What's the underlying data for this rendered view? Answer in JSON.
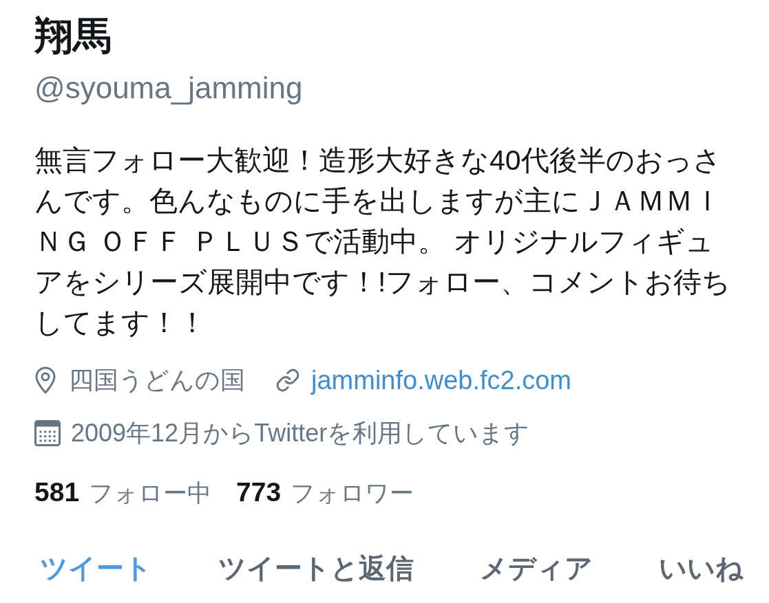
{
  "profile": {
    "name": "翔馬",
    "handle": "@syouma_jamming",
    "bio": "無言フォロー大歓迎！造形大好きな40代後半のおっさんです。色んなものに手を出しますが主にＪＡＭＭＩＮＧ ＯＦＦ ＰＬＵＳで活動中。 オリジナルフィギュアをシリーズ展開中です！!フォロー、コメントお待ちしてます！！"
  },
  "location": "四国うどんの国",
  "website": "jamminfo.web.fc2.com",
  "joined": "2009年12月からTwitterを利用しています",
  "stats": [
    {
      "count": "581",
      "label": "フォロー中"
    },
    {
      "count": "773",
      "label": "フォロワー"
    }
  ],
  "tabs": [
    {
      "label": "ツイート",
      "selected": true
    },
    {
      "label": "ツイートと返信",
      "selected": false
    },
    {
      "label": "メディア",
      "selected": false
    },
    {
      "label": "いいね",
      "selected": false
    }
  ]
}
